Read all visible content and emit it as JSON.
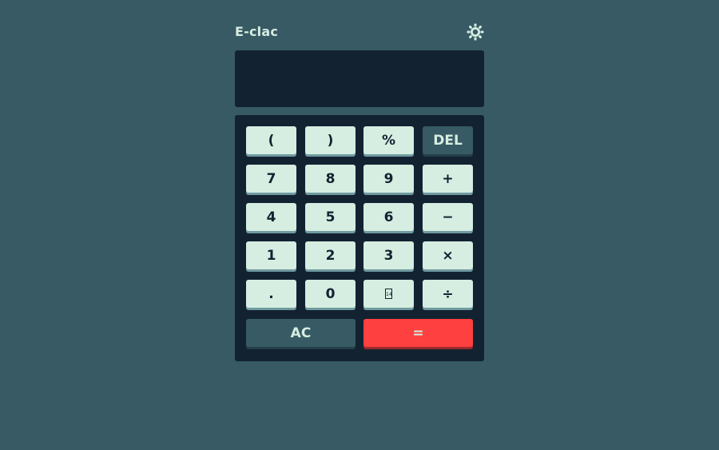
{
  "header": {
    "title": "E-clac",
    "theme_icon": "sun-icon"
  },
  "display": {
    "value": ""
  },
  "keys": {
    "open_paren": "(",
    "close_paren": ")",
    "percent": "%",
    "del": "DEL",
    "seven": "7",
    "eight": "8",
    "nine": "9",
    "plus": "+",
    "four": "4",
    "five": "5",
    "six": "6",
    "minus": "−",
    "one": "1",
    "two": "2",
    "three": "3",
    "multiply": "×",
    "dot": ".",
    "zero": "0",
    "sqrt_glyph": "14",
    "divide": "÷",
    "ac": "AC",
    "equals": "="
  },
  "colors": {
    "background": "#375a64",
    "panel": "#132231",
    "key": "#d6ede1",
    "key_dark": "#375a64",
    "equals": "#ff4040"
  }
}
